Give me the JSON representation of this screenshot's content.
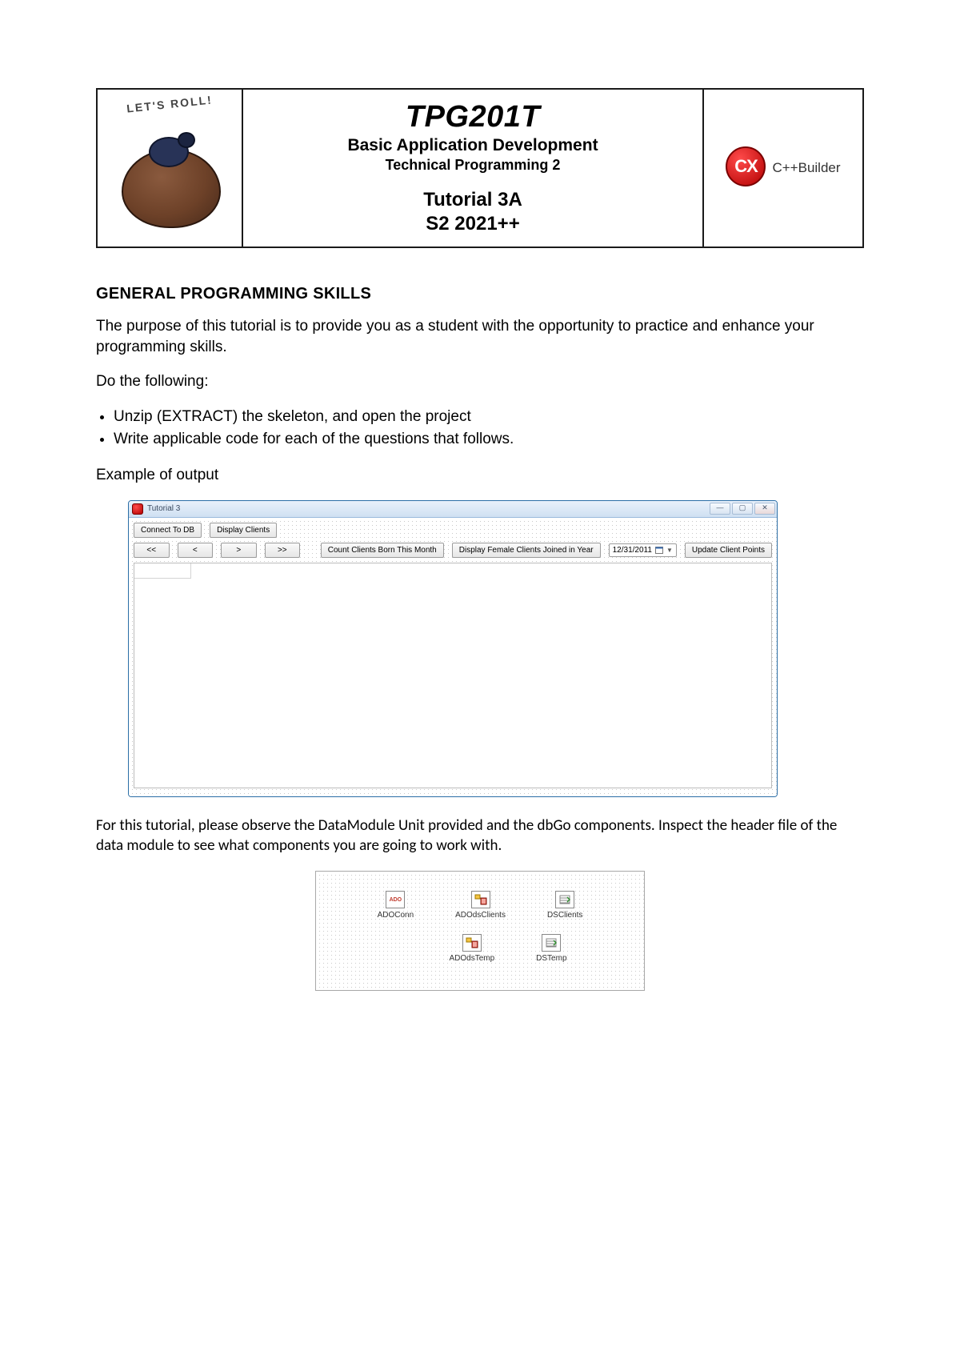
{
  "header": {
    "logo_text": "LET'S ROLL!",
    "course_code": "TPG201T",
    "subtitle1": "Basic Application Development",
    "subtitle2": "Technical Programming 2",
    "tutorial_line1": "Tutorial 3A",
    "tutorial_line2": "S2 2021++",
    "ide_label": "C++Builder",
    "cx_badge": "CX"
  },
  "body": {
    "h2": "GENERAL PROGRAMMING SKILLS",
    "intro": "The purpose of this tutorial is to provide you as a student with the opportunity to practice and  enhance your programming skills.",
    "do_label": "Do the following:",
    "bullets": [
      "Unzip (EXTRACT) the skeleton, and open the project",
      "Write applicable code for each of the questions that follows."
    ],
    "example_label": "Example of output",
    "followup": "For this tutorial, please observe the DataModule Unit provided and the dbGo components. Inspect the header file of the data module to see what components you are going to work with."
  },
  "app_window": {
    "title": "Tutorial 3",
    "buttons": {
      "connect": "Connect To DB",
      "display": "Display Clients",
      "nav_first": "<<",
      "nav_prev": "<",
      "nav_next": ">",
      "nav_last": ">>",
      "count_born": "Count Clients Born This Month",
      "female_year": "Display Female Clients Joined in Year",
      "date_value": "12/31/2011",
      "update_points": "Update Client Points"
    },
    "window_controls": {
      "min": "—",
      "max": "▢",
      "close": "✕"
    }
  },
  "data_module": {
    "row1": [
      "ADOConn",
      "ADOdsClients",
      "DSClients"
    ],
    "row2": [
      "ADOdsTemp",
      "DSTemp"
    ]
  }
}
